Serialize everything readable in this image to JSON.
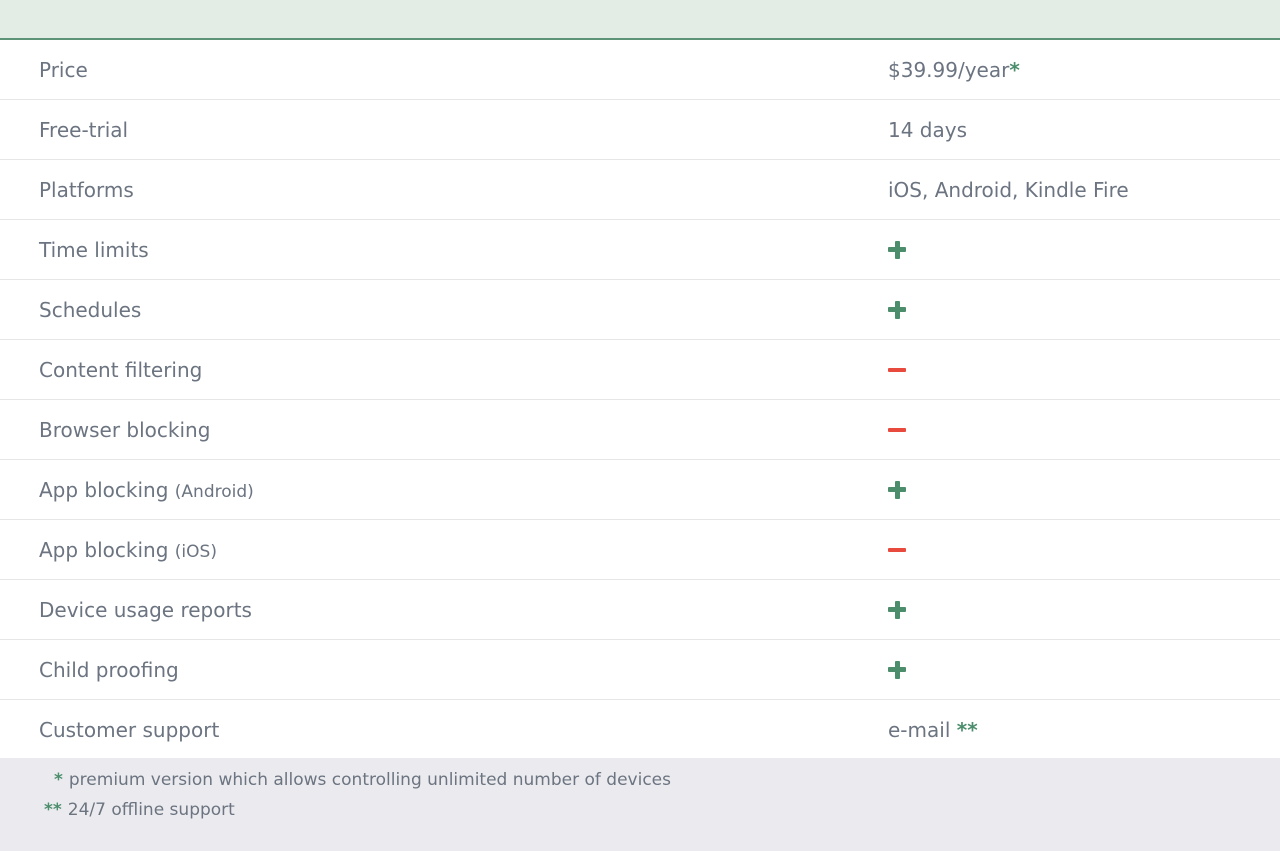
{
  "rows": [
    {
      "label": "Price",
      "sub": "",
      "value": "$39.99/year",
      "marker": "*",
      "icon": ""
    },
    {
      "label": "Free-trial",
      "sub": "",
      "value": "14 days",
      "marker": "",
      "icon": ""
    },
    {
      "label": "Platforms",
      "sub": "",
      "value": "iOS, Android, Kindle Fire",
      "marker": "",
      "icon": ""
    },
    {
      "label": "Time limits",
      "sub": "",
      "value": "",
      "marker": "",
      "icon": "plus-icon"
    },
    {
      "label": "Schedules",
      "sub": "",
      "value": "",
      "marker": "",
      "icon": "plus-icon"
    },
    {
      "label": "Content filtering",
      "sub": "",
      "value": "",
      "marker": "",
      "icon": "minus-icon"
    },
    {
      "label": "Browser blocking",
      "sub": "",
      "value": "",
      "marker": "",
      "icon": "minus-icon"
    },
    {
      "label": "App blocking",
      "sub": "(Android)",
      "value": "",
      "marker": "",
      "icon": "plus-icon"
    },
    {
      "label": "App blocking",
      "sub": "(iOS)",
      "value": "",
      "marker": "",
      "icon": "minus-icon"
    },
    {
      "label": "Device usage reports",
      "sub": "",
      "value": "",
      "marker": "",
      "icon": "plus-icon"
    },
    {
      "label": "Child proofing",
      "sub": "",
      "value": "",
      "marker": "",
      "icon": "plus-icon"
    },
    {
      "label": "Customer support",
      "sub": "",
      "value": "e-mail",
      "marker": "**",
      "icon": ""
    }
  ],
  "footnotes": [
    {
      "mark": "*",
      "text": "premium version which allows controlling unlimited number of devices"
    },
    {
      "mark": "**",
      "text": "24/7 offline support"
    }
  ],
  "colors": {
    "accent_green": "#4c8d6c",
    "minus_red": "#e84a3d",
    "header_bg": "#e3ede6",
    "footnote_bg": "#ebebef"
  }
}
